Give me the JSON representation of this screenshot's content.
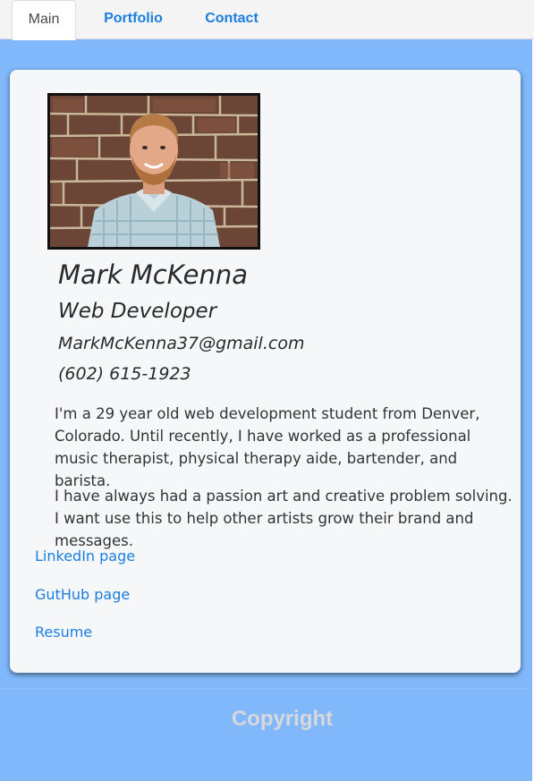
{
  "nav": {
    "tabs": [
      {
        "label": "Main",
        "active": true
      },
      {
        "label": "Portfolio",
        "active": false
      },
      {
        "label": "Contact",
        "active": false
      }
    ]
  },
  "profile": {
    "photo_alt": "profile-photo",
    "name": "Mark McKenna",
    "role": "Web Developer",
    "email": "MarkMcKenna37@gmail.com",
    "phone": "(602) 615-1923"
  },
  "bio": {
    "paragraphs": [
      "I'm a 29 year old web development student from Denver, Colorado. Until recently, I have worked as a professional music therapist, physical therapy aide, bartender, and barista.",
      "I have always had a passion art and creative problem solving. I want use this to help other artists grow their brand and messages."
    ]
  },
  "links": [
    {
      "label": "LinkedIn page"
    },
    {
      "label": "GutHub page"
    },
    {
      "label": "Resume"
    }
  ],
  "footer": {
    "copyright": "Copyright"
  },
  "colors": {
    "page_background": "#80b8fb",
    "card_background": "#f6f7f9",
    "link": "#1b7ee0",
    "footer_text": "#d7d7dc"
  }
}
